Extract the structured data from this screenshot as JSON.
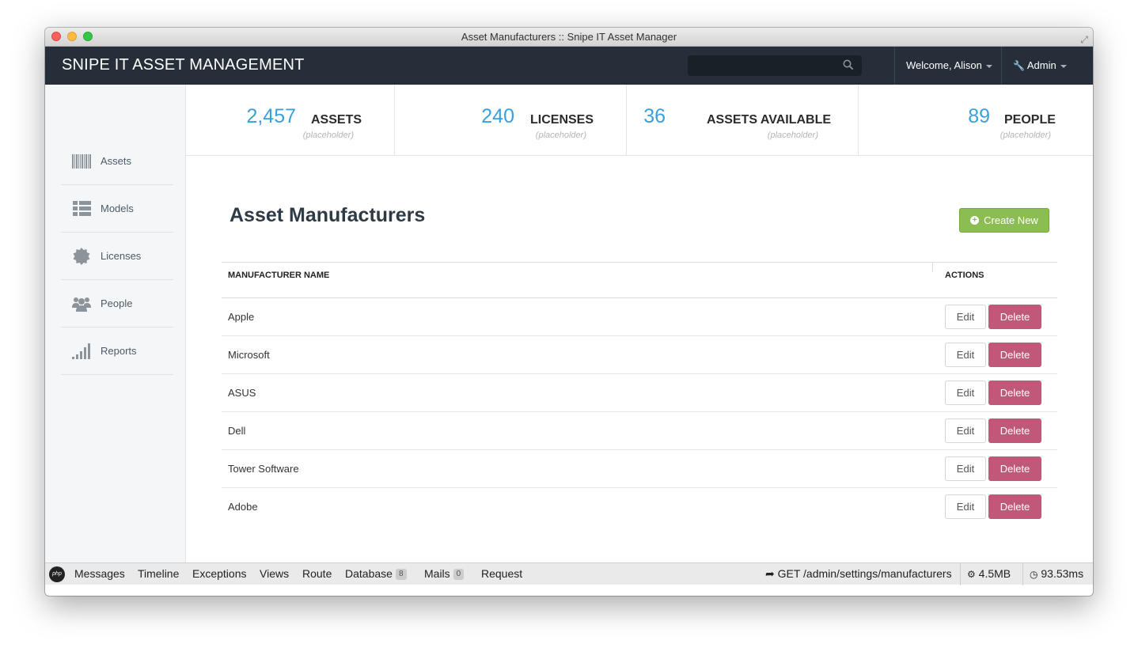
{
  "window": {
    "title": "Asset Manufacturers :: Snipe IT Asset Manager"
  },
  "navbar": {
    "brand": "SNIPE IT ASSET MANAGEMENT",
    "search": {
      "value": "",
      "placeholder": "",
      "icon": "search-icon"
    },
    "user_menu": "Welcome, Alison",
    "admin_menu": "Admin"
  },
  "sidebar": {
    "items": [
      {
        "label": "Assets",
        "icon": "barcode-icon"
      },
      {
        "label": "Models",
        "icon": "list-icon"
      },
      {
        "label": "Licenses",
        "icon": "certificate-icon"
      },
      {
        "label": "People",
        "icon": "users-icon"
      },
      {
        "label": "Reports",
        "icon": "signal-icon"
      }
    ]
  },
  "stats": [
    {
      "value": "2,457",
      "label": "ASSETS",
      "sub": "(placeholder)"
    },
    {
      "value": "240",
      "label": "LICENSES",
      "sub": "(placeholder)"
    },
    {
      "value": "36",
      "label": "ASSETS AVAILABLE",
      "sub": "(placeholder)"
    },
    {
      "value": "89",
      "label": "PEOPLE",
      "sub": "(placeholder)"
    }
  ],
  "page": {
    "title": "Asset Manufacturers",
    "create_button": "Create New"
  },
  "table": {
    "columns": [
      "MANUFACTURER NAME",
      "ACTIONS"
    ],
    "rows": [
      {
        "name": "Apple",
        "edit": "Edit",
        "delete": "Delete"
      },
      {
        "name": "Microsoft",
        "edit": "Edit",
        "delete": "Delete"
      },
      {
        "name": "ASUS",
        "edit": "Edit",
        "delete": "Delete"
      },
      {
        "name": "Dell",
        "edit": "Edit",
        "delete": "Delete"
      },
      {
        "name": "Tower Software",
        "edit": "Edit",
        "delete": "Delete"
      },
      {
        "name": "Adobe",
        "edit": "Edit",
        "delete": "Delete"
      }
    ]
  },
  "debugbar": {
    "logo": "php",
    "tabs": [
      "Messages",
      "Timeline",
      "Exceptions",
      "Views",
      "Route"
    ],
    "database": {
      "label": "Database",
      "count": "8"
    },
    "mails": {
      "label": "Mails",
      "count": "0"
    },
    "request": "Request",
    "route_info": "GET /admin/settings/manufacturers",
    "memory": "4.5MB",
    "time": "93.53ms"
  },
  "colors": {
    "navbar": "#262f39",
    "stat_number": "#3aa0dc",
    "create_button": "#8cbd52",
    "delete_button": "#c0587a"
  }
}
